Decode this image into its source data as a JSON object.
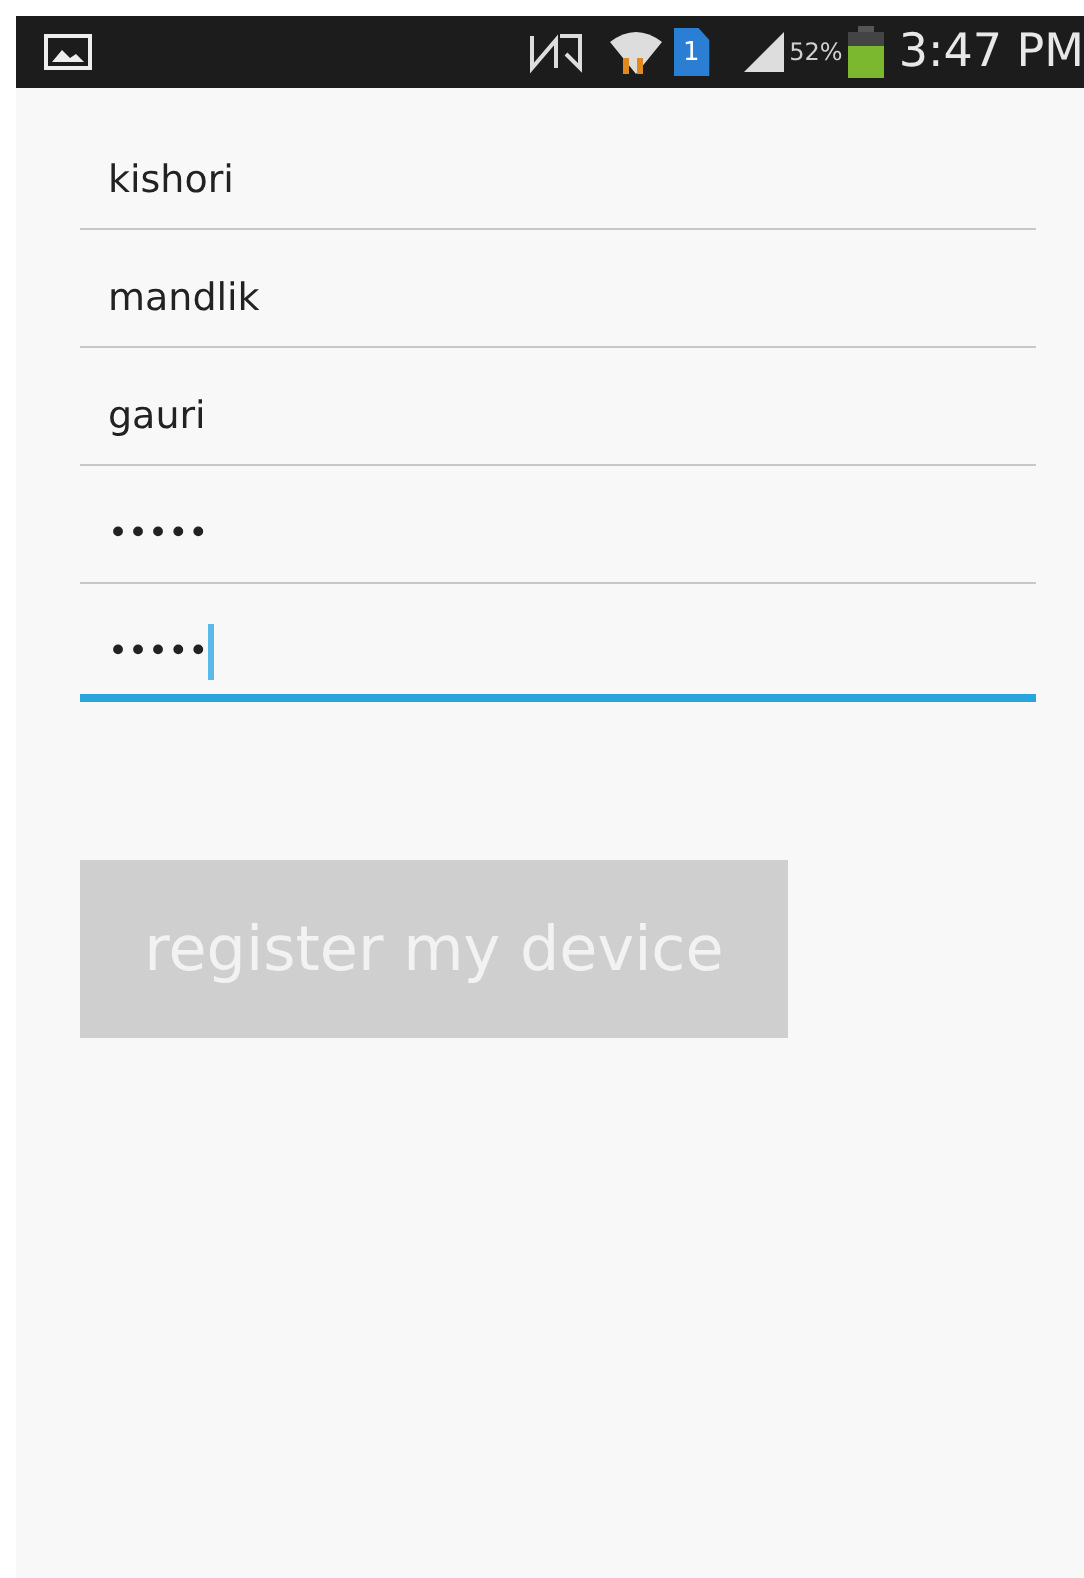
{
  "status_bar": {
    "sim_badge": "1",
    "battery_percent": "52%",
    "time": "3:47 PM"
  },
  "fields": [
    {
      "kind": "text",
      "value": "kishori",
      "focused": false
    },
    {
      "kind": "text",
      "value": "mandlik",
      "focused": false
    },
    {
      "kind": "text",
      "value": "gauri",
      "focused": false
    },
    {
      "kind": "password",
      "value": "•••••",
      "focused": false
    },
    {
      "kind": "password",
      "value": "•••••",
      "focused": true
    }
  ],
  "button": {
    "label": "register my device",
    "disabled": true
  }
}
